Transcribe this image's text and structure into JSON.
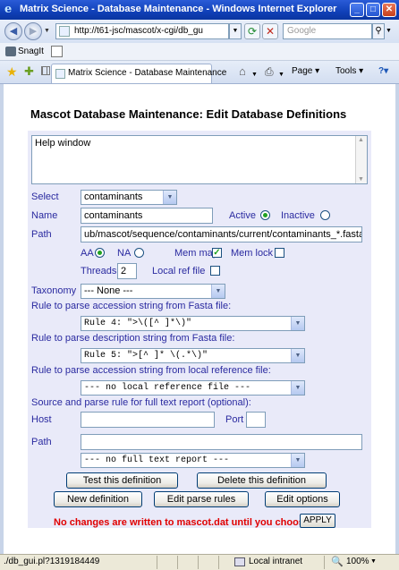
{
  "window": {
    "title": "Matrix Science - Database Maintenance - Windows Internet Explorer",
    "min": "_",
    "max": "□",
    "close": "✕"
  },
  "browser": {
    "url": "http://t61-jsc/mascot/x-cgi/db_gu",
    "search_placeholder": "Google",
    "snagit_label": "SnagIt",
    "tab_title": "Matrix Science - Database Maintenance",
    "page_menu": "Page ▾",
    "tools_menu": "Tools ▾",
    "help_menu": "?▾"
  },
  "page": {
    "title": "Mascot Database Maintenance: Edit Database Definitions",
    "help_text": "Help window",
    "select_label": "Select",
    "select_value": "contaminants",
    "name_label": "Name",
    "name_value": "contaminants",
    "active_label": "Active",
    "active_selected": true,
    "inactive_label": "Inactive",
    "path_label": "Path",
    "path_value": "ub/mascot/sequence/contaminants/current/contaminants_*.fasta",
    "aa_label": "AA",
    "aa_selected": true,
    "na_label": "NA",
    "memmap_label": "Mem map",
    "memmap_checked": true,
    "memlock_label": "Mem lock",
    "memlock_checked": false,
    "threads_label": "Threads",
    "threads_value": "2",
    "localref_label": "Local ref file",
    "localref_checked": false,
    "taxonomy_label": "Taxonomy",
    "taxonomy_value": "--- None ---",
    "rule_accession_label": "Rule to parse accession string from Fasta file:",
    "rule_accession_value": "Rule 4: \">\\([^ ]*\\)\"",
    "rule_description_label": "Rule to parse description string from Fasta file:",
    "rule_description_value": "Rule 5: \">[^ ]* \\(.*\\)\"",
    "rule_localref_label": "Rule to parse accession string from local reference file:",
    "rule_localref_value": "--- no local reference file ---",
    "source_label": "Source and parse rule for full text report (optional):",
    "host_label": "Host",
    "host_value": "",
    "port_label": "Port",
    "port_value": "",
    "fullpath_label": "Path",
    "fullpath_value": "",
    "fulltext_value": "--- no full text report ---",
    "test_button": "Test this definition",
    "delete_button": "Delete this definition",
    "new_button": "New definition",
    "edit_rules_button": "Edit parse rules",
    "edit_options_button": "Edit options",
    "warning": "No changes are written to mascot.dat until you choose:",
    "apply_button": "APPLY"
  },
  "status": {
    "url": "./db_gui.pl?1319184449",
    "zone": "Local intranet",
    "zoom": "100%"
  },
  "colors": {
    "label_blue": "#2a2aa0",
    "panel_bg": "#e9eaf9",
    "warning_red": "#e00000",
    "titlebar_blue": "#1040b8"
  }
}
